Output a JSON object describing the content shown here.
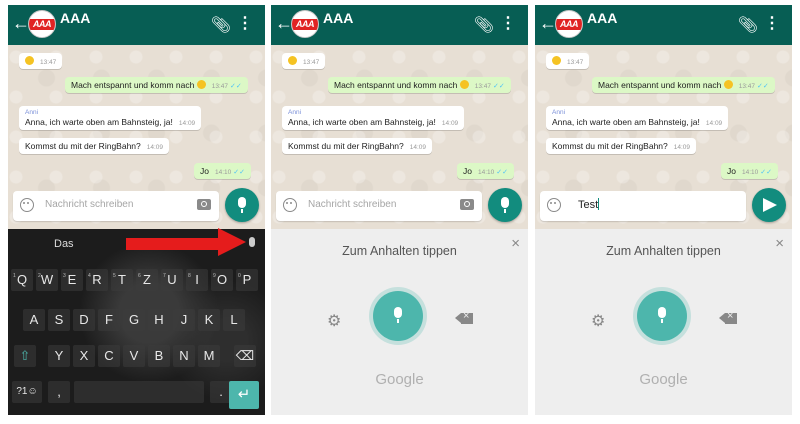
{
  "colors": {
    "appbar": "#075e54",
    "outgoing": "#dcf8c6",
    "accent": "#128c7e",
    "mic_circle": "#4db6ac",
    "annotation_arrow": "#e51c1c"
  },
  "chat": {
    "title": "AAA",
    "avatar_text": "AAA",
    "icons": {
      "back": "back-arrow-icon",
      "attach": "paperclip-icon",
      "menu": "more-vert-icon"
    },
    "messages": [
      {
        "direction": "in",
        "emoji": "grinning-face",
        "time": "13:47"
      },
      {
        "direction": "out",
        "text": "Mach entspannt und komm nach",
        "time": "13:47"
      },
      {
        "direction": "in",
        "sender": "Anni",
        "text": "Anna, ich warte oben am Bahnsteig, ja!",
        "time": "14:09"
      },
      {
        "direction": "in",
        "text": "Kommst du mit der RingBahn?",
        "time": "14:09"
      },
      {
        "direction": "out",
        "text": "Jo",
        "time": "14:10"
      }
    ],
    "input_placeholder": "Nachricht schreiben",
    "typed_text": "Test"
  },
  "keyboard": {
    "suggestion": "Das",
    "rows": [
      {
        "keys": [
          "Q",
          "W",
          "E",
          "R",
          "T",
          "Z",
          "U",
          "I",
          "O",
          "P"
        ],
        "hints": [
          "1",
          "2",
          "3",
          "4",
          "5",
          "6",
          "7",
          "8",
          "9",
          "0"
        ]
      },
      {
        "keys": [
          "A",
          "S",
          "D",
          "F",
          "G",
          "H",
          "J",
          "K",
          "L"
        ]
      },
      {
        "keys": [
          "⇧",
          "Y",
          "X",
          "C",
          "V",
          "B",
          "N",
          "M",
          "⌫"
        ]
      },
      {
        "keys": [
          "?1☺",
          ",",
          "",
          "",
          ".",
          "↵"
        ]
      }
    ]
  },
  "voice": {
    "prompt": "Zum Anhalten tippen",
    "brand": "Google",
    "close": "×"
  }
}
